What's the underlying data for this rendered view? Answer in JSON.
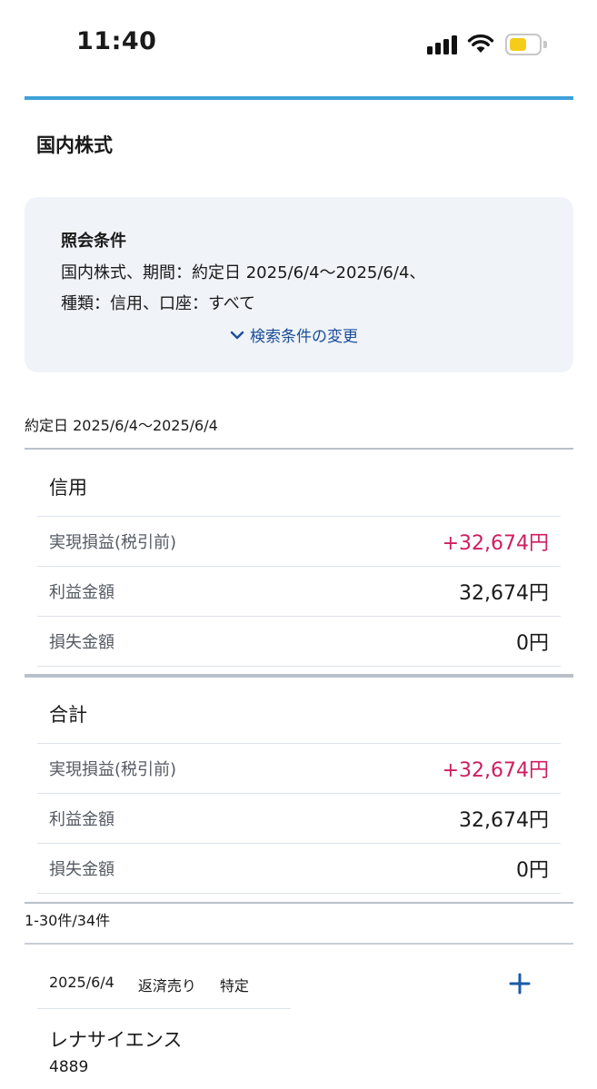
{
  "status_bar": {
    "time": "11:40",
    "battery_color": "#f5cc1a"
  },
  "page": {
    "title": "国内株式",
    "accent_color": "#3ea1d8"
  },
  "conditions": {
    "heading": "照会条件",
    "line1": "国内株式、期間：約定日 2025/6/4〜2025/6/4、",
    "line2": "種類：信用、口座：すべて",
    "change_label": "検索条件の変更"
  },
  "date_range": "約定日 2025/6/4〜2025/6/4",
  "sections": [
    {
      "title": "信用",
      "rows": [
        {
          "label": "実現損益(税引前)",
          "value": "+32,674円"
        },
        {
          "label": "利益金額",
          "value": "32,674円"
        },
        {
          "label": "損失金額",
          "value": "0円"
        }
      ]
    },
    {
      "title": "合計",
      "rows": [
        {
          "label": "実現損益(税引前)",
          "value": "+32,674円"
        },
        {
          "label": "利益金額",
          "value": "32,674円"
        },
        {
          "label": "損失金額",
          "value": "0円"
        }
      ]
    }
  ],
  "count": "1-30件/34件",
  "items": [
    {
      "date": "2025/6/4",
      "trade_type": "返済売り",
      "account": "特定",
      "name": "レナサイエンス",
      "code": "4889"
    }
  ],
  "colors": {
    "positive": "#cf1e5f",
    "link": "#1a4e9a"
  }
}
